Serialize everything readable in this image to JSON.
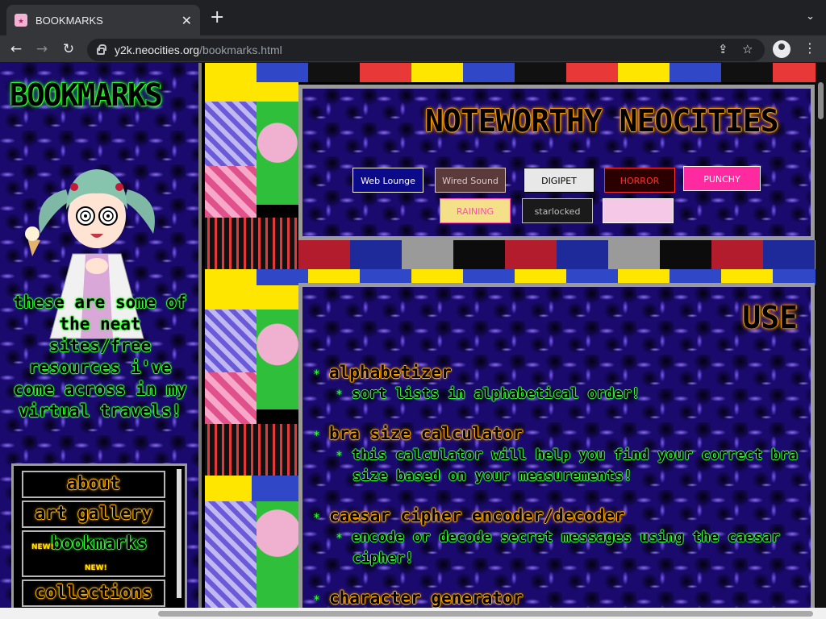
{
  "browser": {
    "tab_title": "BOOKMARKS",
    "url_host": "y2k.neocities.org",
    "url_path": "/bookmarks.html"
  },
  "sidebar": {
    "logo": "BOOKMARKS",
    "blurb": "these are some of the neat sites/free resources i've come across in my virtual travels!",
    "nav": [
      {
        "label": "about"
      },
      {
        "label": "art gallery"
      },
      {
        "label": "bookmarks",
        "badge": "NEW!"
      },
      {
        "label": "collections"
      }
    ]
  },
  "noteworthy": {
    "title": "NOTEWORTHY NEOCITIES",
    "buttons": [
      {
        "label": "Web Lounge",
        "bg": "#0a0a8a",
        "fg": "#ffffff"
      },
      {
        "label": "Wired Sound",
        "bg": "#5a3a3a",
        "fg": "#e0c8c8"
      },
      {
        "label": "DIGIPET",
        "bg": "#e8e8e8",
        "fg": "#000000"
      },
      {
        "label": "HORROR",
        "bg": "#2a0000",
        "fg": "#ff3030"
      },
      {
        "label": "PUNCHY",
        "bg": "#ff2aa0",
        "fg": "#ffffff"
      },
      {
        "label": "RAINING",
        "bg": "#f5e08a",
        "fg": "#ff4fb0"
      },
      {
        "label": "starlocked",
        "bg": "#1a1a1a",
        "fg": "#c0c0c0"
      },
      {
        "label": "",
        "bg": "#f5c8e8",
        "fg": "#ffffff"
      }
    ]
  },
  "main": {
    "title": "USE",
    "entries": [
      {
        "name": "alphabetizer",
        "desc": "sort lists in alphabetical order!"
      },
      {
        "name": "bra size calculator",
        "desc": "this calculator will help you find your correct bra size based on your measurements!"
      },
      {
        "name": "caesar cipher encoder/decoder",
        "desc": "encode or decode secret messages using the caesar cipher!"
      },
      {
        "name": "character generator",
        "desc": ""
      }
    ]
  },
  "colors": {
    "neon_green": "#35ff35",
    "neon_orange": "#ffb000",
    "panel_border": "#9a9a9a"
  }
}
